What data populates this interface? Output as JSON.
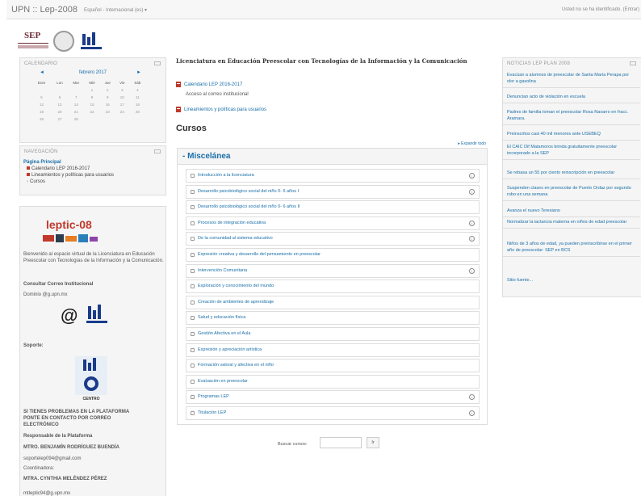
{
  "header": {
    "site_name": "UPN :: Lep-2008",
    "language": "Español - Internacional (es) ▾",
    "login_info": "Usted no se ha identificado. (Entrar)"
  },
  "logos": {
    "sep_text": "SEP"
  },
  "calendar": {
    "title": "CALENDARIO",
    "month": "febrero 2017",
    "prev": "◄",
    "next": "►",
    "weekdays": [
      "Dom",
      "Lun",
      "Mar",
      "Mié",
      "Jue",
      "Vie",
      "Sáb"
    ],
    "weeks": [
      [
        "",
        "",
        "",
        "1",
        "2",
        "3",
        "4"
      ],
      [
        "5",
        "6",
        "7",
        "8",
        "9",
        "10",
        "11"
      ],
      [
        "12",
        "13",
        "14",
        "15",
        "16",
        "17",
        "18"
      ],
      [
        "19",
        "20",
        "21",
        "22",
        "23",
        "24",
        "25"
      ],
      [
        "26",
        "27",
        "28",
        "",
        "",
        "",
        ""
      ]
    ]
  },
  "navigation": {
    "title": "NAVEGACIÓN",
    "home": "Página Principal",
    "items": [
      "Calendario LEP 2016-2017",
      "Lineamientos y políticas para usuarios",
      "Cursos"
    ]
  },
  "leptic": {
    "title": "leptic-08",
    "welcome": "Bienvenido al espacio virtual de la Licenciatura en Educación Preescolar con Tecnologías de la Información y la Comunicación.",
    "correo_label": "Consultar Correo Institucional",
    "dominio": "Dominio @g.upn.mx",
    "soporte": "Soporte:",
    "problemas": "SI TIENES PROBLEMAS EN LA PLATAFORMA PONTE EN CONTACTO POR CORREO ELECTRÓNICO",
    "responsable_label": "Responsable de la Plataforma",
    "responsable": "MTRO. BENJAMÍN RODRÍGUEZ BUENDÍA",
    "responsable_email": "soportelep094@gmail.com",
    "coordinadora_label": "Coordinadora:",
    "coordinadora": "MTRA. CYNTHIA MELÉNDEZ PÉREZ",
    "coordinadora_email": "mtleptic94@g.upn.mx",
    "centro": "CENTRO"
  },
  "main": {
    "heading": "Licenciatura en Educación Preescolar con  Tecnologías de la Información y la Comunicación",
    "link1": "Calendario LEP 2016-2017",
    "plain1": "Acceso al correo institucional",
    "link2": "Lineamientos y políticas para usuarios",
    "courses_title": "Cursos",
    "expand_all": "▸ Expandir todo",
    "category": "Miscelánea",
    "courses": [
      {
        "name": "Introducción a la licenciatura",
        "info": true
      },
      {
        "name": "Desarrollo psicobiológico social del niño 0- 6 años I",
        "info": true
      },
      {
        "name": "Desarrollo psicobiológico social del niño 0- 6 años II",
        "info": false
      },
      {
        "name": "Procesos de integración educativa",
        "info": true
      },
      {
        "name": "De la comunidad al sistema educativo",
        "info": true
      },
      {
        "name": "Expresión creativa y desarrollo del pensamiento en preescolar",
        "info": false
      },
      {
        "name": "Intervención Comunitaria",
        "info": true
      },
      {
        "name": "Exploración y conocimiento del mundo",
        "info": false
      },
      {
        "name": "Creación de ambientes de aprendizaje",
        "info": false
      },
      {
        "name": "Salud y educación física",
        "info": false
      },
      {
        "name": "Gestión Afectiva en el Aula",
        "info": false
      },
      {
        "name": "Expresión y apreciación artística",
        "info": false
      },
      {
        "name": "Formación valoral y afectiva en el niño",
        "info": false
      },
      {
        "name": "Evaluación en preescolar",
        "info": false
      },
      {
        "name": "Programas LEP",
        "info": true
      },
      {
        "name": "Titulación LEP",
        "info": true
      }
    ],
    "search_label": "Buscar cursos:",
    "search_value": "",
    "search_button": "Ir"
  },
  "news": {
    "title": "NOTICIAS LEP PLAN 2008",
    "items": [
      "Evacúan a alumnos de preescolar de Santa María Perapa por olor a gasolina",
      "Denuncian acto de violación en escuela",
      "Padres de familia toman el preescolar Rosa Navarro en fracc. Aramara.",
      "Preinscritos casi 40 mil menores ante USEBEQ",
      "El CAIC Dif Matamoros brinda gratuitamente preescolar incorporado a la SEP",
      "Se rebasa un 55 por ciento reinscripción en preescolar",
      "Suspenden clases en preescolar de Puerto Ordaz por segundo robo en una semana",
      "Avanza el nuevo Teresiano",
      "Normalizar la lactancia materna en niños de edad preescolar",
      "Niños de 3 años de edad, ya pueden preinscribirse en el primer año de preescolar: SEP en BCS"
    ],
    "footer": "Sitio fuente..."
  }
}
